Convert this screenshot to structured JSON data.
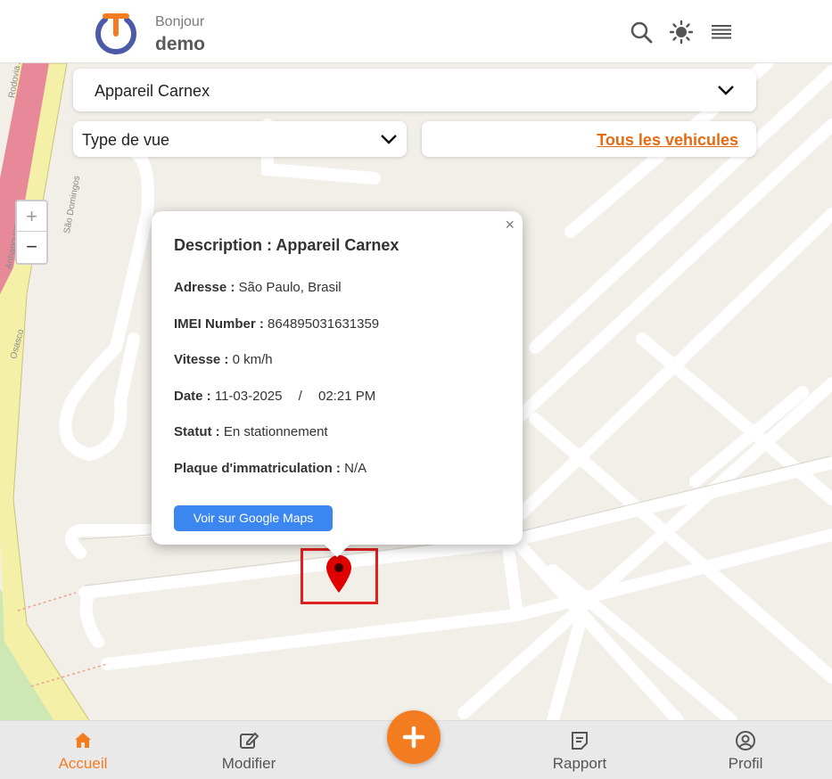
{
  "header": {
    "greeting": "Bonjour",
    "username": "demo",
    "icons": [
      "search-icon",
      "sun-icon",
      "menu-icon"
    ]
  },
  "controls": {
    "device_select": "Appareil Carnex",
    "view_type_select": "Type de vue",
    "vehicles_link": "Tous les vehicules"
  },
  "zoom": {
    "in": "+",
    "out": "−"
  },
  "map_labels": {
    "road1": "Rodovia Anhanguera",
    "road2": "Anhanguera",
    "street": "São Domingos",
    "district": "Osasco"
  },
  "popup": {
    "close": "×",
    "title": "Description : Appareil Carnex",
    "address_label": "Adresse :",
    "address_value": "São Paulo, Brasil",
    "imei_label": "IMEI Number :",
    "imei_value": "864895031631359",
    "speed_label": "Vitesse :",
    "speed_value": "0 km/h",
    "date_label": "Date :",
    "date_value": "11-03-2025",
    "date_sep": "/",
    "time_value": "02:21 PM",
    "status_label": "Statut :",
    "status_value": "En stationnement",
    "plate_label": "Plaque d'immatriculation :",
    "plate_value": "N/A",
    "gmaps_button": "Voir sur Google Maps"
  },
  "bottom_nav": {
    "items": [
      {
        "label": "Accueil",
        "icon": "home-icon",
        "active": true
      },
      {
        "label": "Modifier",
        "icon": "edit-icon",
        "active": false
      },
      {
        "label": "Rapport",
        "icon": "report-icon",
        "active": false
      },
      {
        "label": "Profil",
        "icon": "profile-icon",
        "active": false
      }
    ],
    "fab_icon": "plus-icon"
  },
  "colors": {
    "accent": "#f47c20",
    "link": "#e56a12",
    "button": "#3c86f0",
    "marker": "#e00000",
    "highlight_box": "#e02020"
  }
}
